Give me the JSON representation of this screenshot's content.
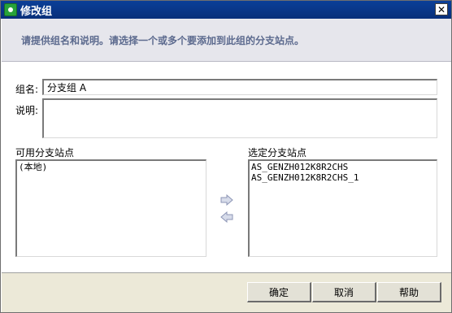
{
  "window": {
    "title": "修改组",
    "close_glyph": "✕"
  },
  "header": {
    "instruction": "请提供组名和说明。请选择一个或多个要添加到此组的分支站点。"
  },
  "form": {
    "group_name_label": "组名:",
    "group_name_value": "分支组 A",
    "description_label": "说明:",
    "description_value": ""
  },
  "available": {
    "label": "可用分支站点",
    "items": [
      "(本地)"
    ]
  },
  "selected": {
    "label": "选定分支站点",
    "items": [
      "AS_GENZH012K8R2CHS",
      "AS_GENZH012K8R2CHS_1"
    ]
  },
  "arrows": {
    "add_icon": "arrow-right-icon",
    "remove_icon": "arrow-left-icon"
  },
  "buttons": {
    "ok": "确定",
    "cancel": "取消",
    "help": "帮助"
  },
  "colors": {
    "titlebar": "#0b3f98",
    "instruction_text": "#5c6a8e",
    "header_band": "#e6e6ec",
    "dialog_face": "#ece9d8"
  }
}
